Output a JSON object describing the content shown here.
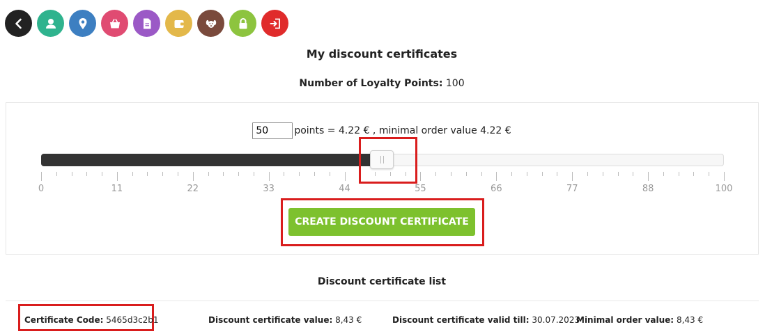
{
  "nav": [
    {
      "icon": "back-icon",
      "color": "#222222"
    },
    {
      "icon": "user-icon",
      "color": "#2fb38e"
    },
    {
      "icon": "location-pin-icon",
      "color": "#3d7fc1"
    },
    {
      "icon": "shopping-basket-icon",
      "color": "#e04b72"
    },
    {
      "icon": "document-icon",
      "color": "#9b59c6"
    },
    {
      "icon": "wallet-icon",
      "color": "#e3b84a"
    },
    {
      "icon": "dog-icon",
      "color": "#7a4a3c"
    },
    {
      "icon": "lock-icon",
      "color": "#8dc43f"
    },
    {
      "icon": "logout-icon",
      "color": "#e02b2b"
    }
  ],
  "page_title": "My discount certificates",
  "loyalty": {
    "label": "Number of Loyalty Points:",
    "value": "100"
  },
  "converter": {
    "points_value": "50",
    "text": "points = 4.22 € , minimal order value 4.22 €"
  },
  "slider": {
    "min": 0,
    "max": 100,
    "value": 50,
    "tick_labels": [
      "0",
      "11",
      "22",
      "33",
      "44",
      "55",
      "66",
      "77",
      "88",
      "100"
    ],
    "fill_color": "#333333"
  },
  "create_button_label": "CREATE DISCOUNT CERTIFICATE",
  "accent_color": "#7dc12e",
  "list_title": "Discount certificate list",
  "certificate": {
    "code_label": "Certificate Code:",
    "code": "5465d3c2b1",
    "value_label": "Discount certificate value:",
    "value": "8,43 €",
    "valid_label": "Discount certificate valid till:",
    "valid": "30.07.2023",
    "min_label": "Minimal order value:",
    "min": "8,43 €"
  }
}
